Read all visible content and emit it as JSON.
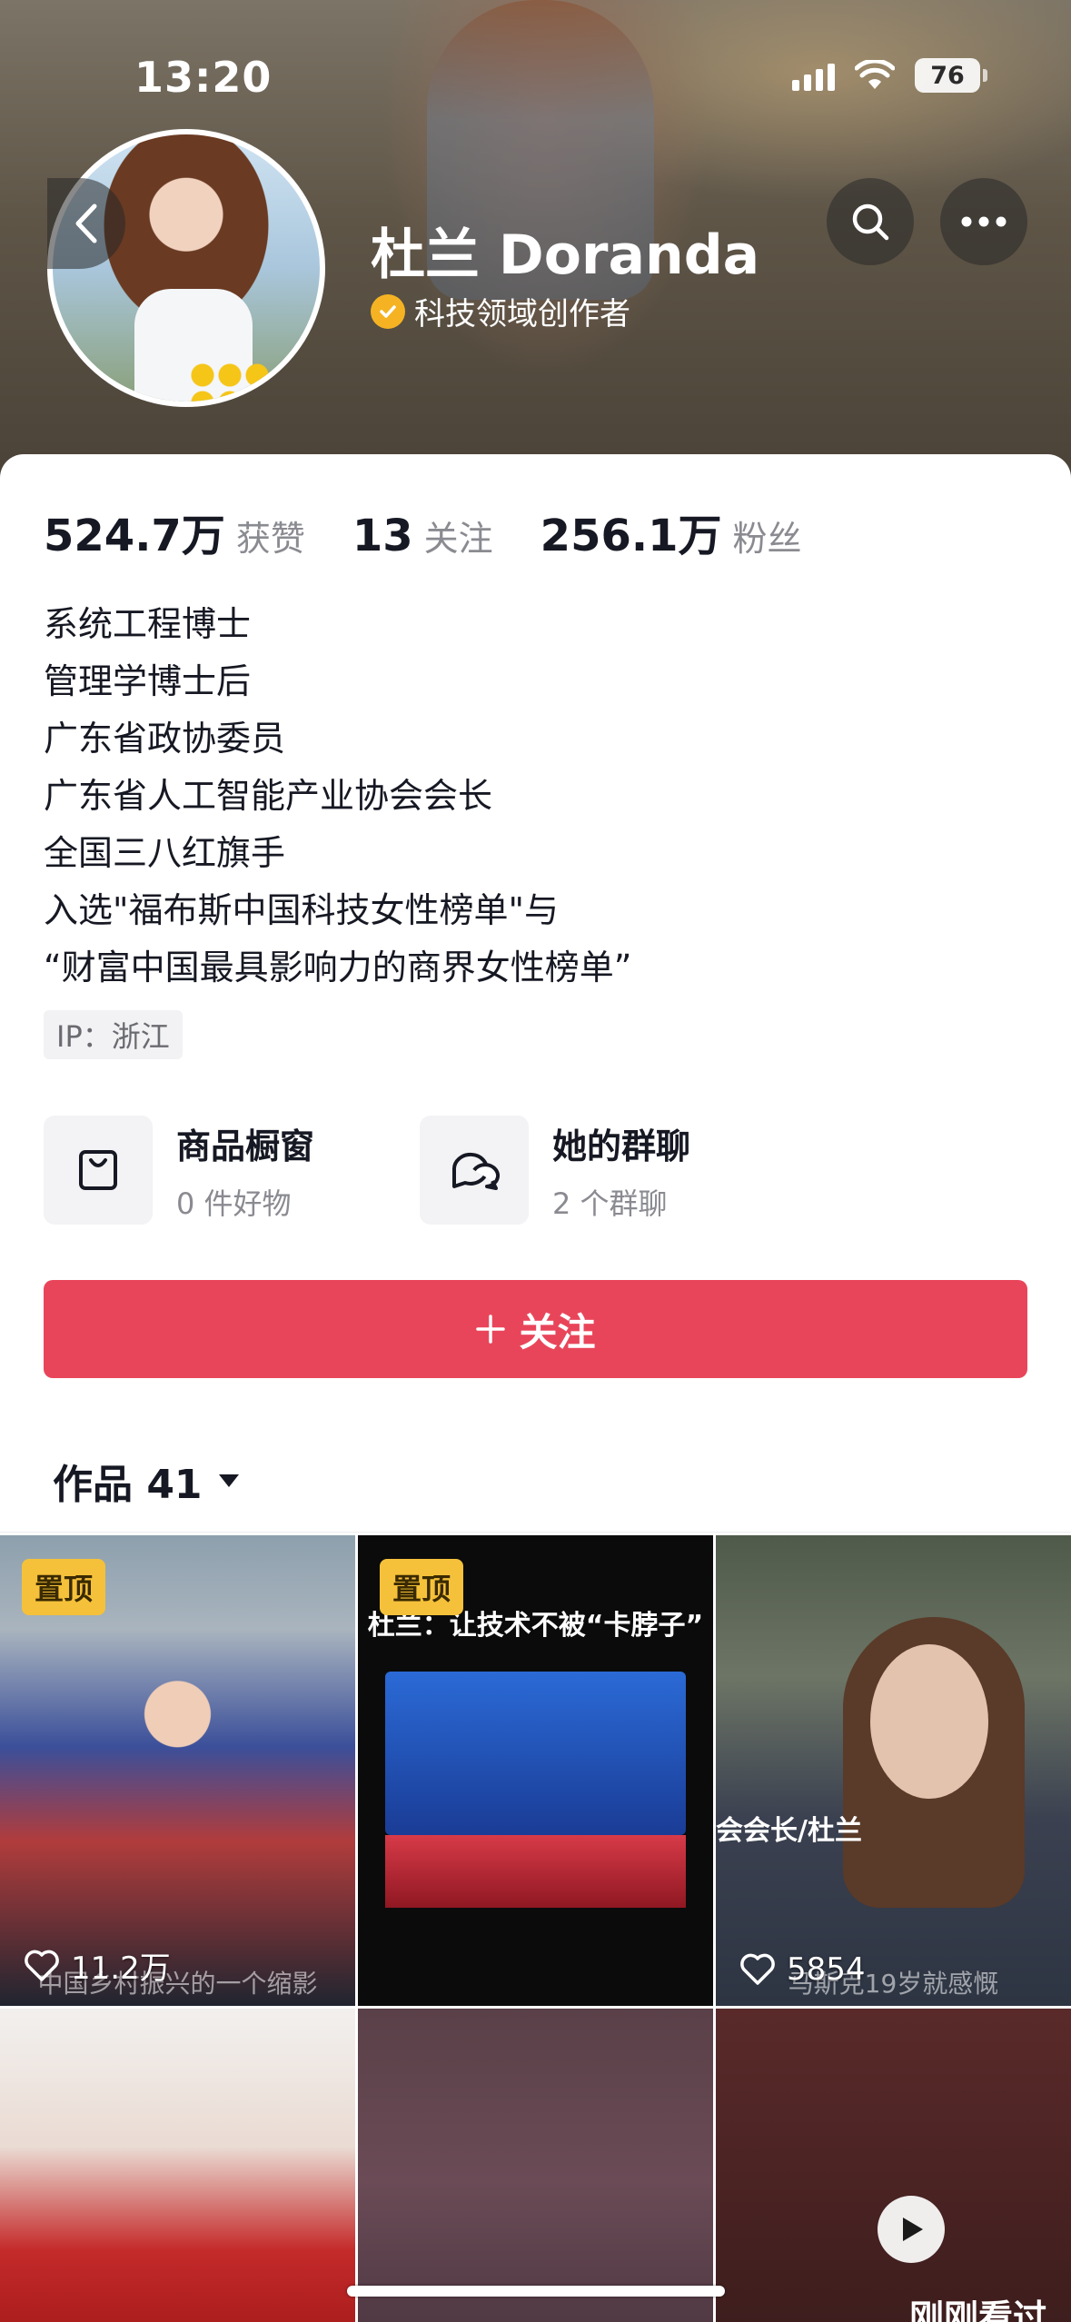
{
  "status_bar": {
    "time": "13:20",
    "battery": "76"
  },
  "profile": {
    "name": "杜兰 Doranda",
    "verification": "科技领域创作者"
  },
  "stats": [
    {
      "value": "524.7万",
      "label": "获赞"
    },
    {
      "value": "13",
      "label": "关注"
    },
    {
      "value": "256.1万",
      "label": "粉丝"
    }
  ],
  "bio": [
    "系统工程博士",
    "管理学博士后",
    "广东省政协委员",
    "广东省人工智能产业协会会长",
    "全国三八红旗手",
    "入选\"福布斯中国科技女性榜单\"与",
    "“财富中国最具影响力的商界女性榜单”"
  ],
  "ip_location": "IP：浙江",
  "entries": [
    {
      "title": "商品橱窗",
      "subtitle": "0 件好物",
      "icon": "shopping-bag-icon"
    },
    {
      "title": "她的群聊",
      "subtitle": "2 个群聊",
      "icon": "chat-bubbles-icon"
    }
  ],
  "follow_button": "关注",
  "works_tab": {
    "label": "作品 41"
  },
  "videos": [
    {
      "pinned": "置顶",
      "likes": "11.2万",
      "caption": "中国乡村振兴的一个缩影"
    },
    {
      "pinned": "置顶",
      "headline": "杜兰：让技术不被“卡脖子”"
    },
    {
      "likes": "5854",
      "caption": "马斯克19岁就感慨",
      "overlay_label": "会会长/杜兰"
    },
    {},
    {},
    {
      "badge": "刚刚看过"
    }
  ],
  "colors": {
    "accent": "#e9455a",
    "pin": "#f5c13b",
    "verify": "#f5b324"
  }
}
